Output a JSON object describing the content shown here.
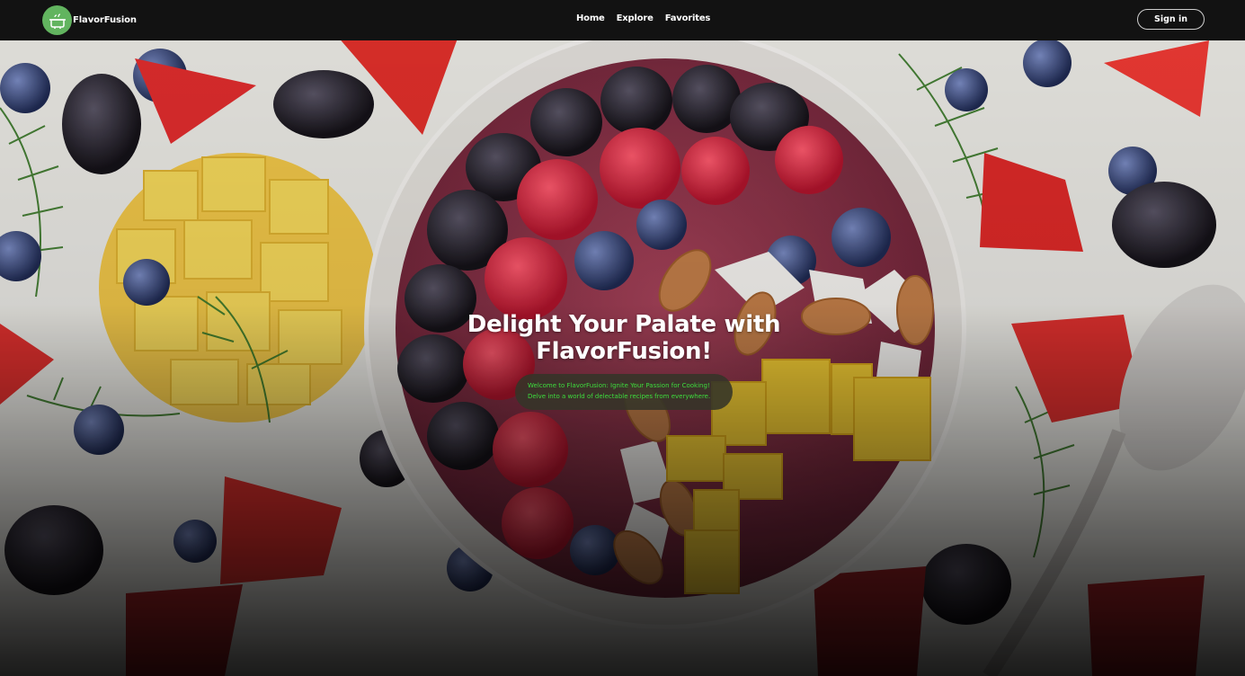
{
  "navbar": {
    "brand_name": "FlavorFusion",
    "logo_icon": "cooking-pot-icon",
    "links": [
      "Home",
      "Explore",
      "Favorites"
    ],
    "signin_label": "Sign in"
  },
  "hero": {
    "title_line1": "Delight Your Palate with",
    "title_line2": "FlavorFusion!",
    "sub_line1": "Welcome to FlavorFusion: Ignite Your Passion for Cooking!",
    "sub_line2": "Delve into a world of delectable recipes from everywhere.",
    "background_image": "smoothie-bowl-with-berries-mango-almonds-photo"
  },
  "colors": {
    "brand_green": "#62b45f",
    "tagline_green": "#3ddc3d",
    "navbar_bg": "#121212"
  }
}
